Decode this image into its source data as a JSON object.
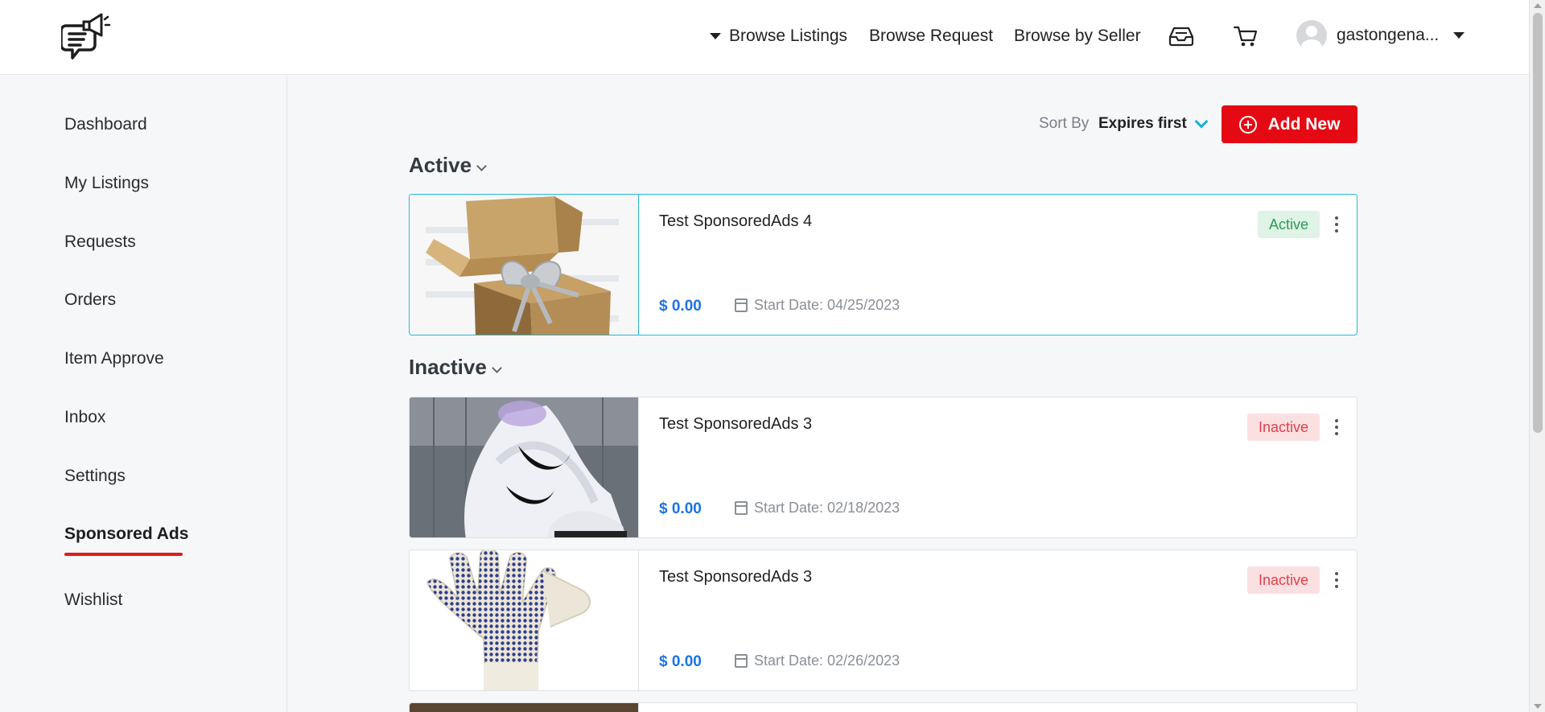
{
  "header": {
    "logo_icon": "megaphone-chat-icon",
    "nav": {
      "browse_listings": "Browse Listings",
      "browse_request": "Browse Request",
      "browse_seller": "Browse by Seller"
    },
    "inbox_icon": "inbox-tray-icon",
    "cart_icon": "shopping-cart-icon",
    "username": "gastongena..."
  },
  "sidebar": {
    "items": [
      {
        "label": "Dashboard"
      },
      {
        "label": "My Listings"
      },
      {
        "label": "Requests"
      },
      {
        "label": "Orders"
      },
      {
        "label": "Item Approve"
      },
      {
        "label": "Inbox"
      },
      {
        "label": "Settings"
      },
      {
        "label": "Sponsored Ads",
        "active": true
      },
      {
        "label": "Wishlist"
      }
    ],
    "active_color": "#e21a1a"
  },
  "toolbar": {
    "sort_label": "Sort By",
    "sort_value": "Expires first",
    "add_label": "Add New",
    "add_color": "#e50914"
  },
  "sections": {
    "active": {
      "title": "Active",
      "cards": [
        {
          "title": "Test SponsoredAds 4",
          "price": "$ 0.00",
          "date": "Start Date: 04/25/2023",
          "status": "Active",
          "image": "gift-box-image"
        }
      ]
    },
    "inactive": {
      "title": "Inactive",
      "cards": [
        {
          "title": "Test SponsoredAds 3",
          "price": "$ 0.00",
          "date": "Start Date: 02/18/2023",
          "status": "Inactive",
          "image": "sneakers-image"
        },
        {
          "title": "Test SponsoredAds 3",
          "price": "$ 0.00",
          "date": "Start Date: 02/26/2023",
          "status": "Inactive",
          "image": "work-glove-image"
        }
      ]
    }
  },
  "colors": {
    "active_badge_bg": "#dff3e6",
    "active_badge_text": "#2e9b55",
    "inactive_badge_bg": "#fbe0e1",
    "inactive_badge_text": "#e0404a",
    "price": "#1a73e8",
    "selected_border": "#26b8dc"
  }
}
